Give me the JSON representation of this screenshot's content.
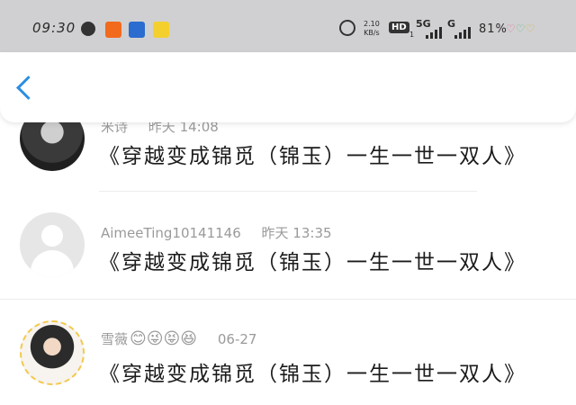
{
  "status_bar": {
    "time": "09:30",
    "net_speed_top": "2.10",
    "net_speed_bottom": "KB/s",
    "hd": "HD",
    "hd_sub": "1",
    "sig1": "5G",
    "sig2": "G",
    "battery": "81%",
    "icons": [
      "globe-icon",
      "app-icon",
      "baidu-icon",
      "app-icon",
      "alarm-icon"
    ]
  },
  "header": {
    "back_icon": "chevron-left-icon"
  },
  "comments": [
    {
      "user": "米诗",
      "time": "昨天 14:08",
      "text": "《穿越变成锦觅（锦玉）一生一世一双人》"
    },
    {
      "user": "AimeeTing10141146",
      "time": "昨天 13:35",
      "text": "《穿越变成锦觅（锦玉）一生一世一双人》"
    },
    {
      "user": "雪薇",
      "emojis": "😊😜😝😆",
      "time": "06-27",
      "text": "《穿越变成锦觅（锦玉）一生一世一双人》"
    }
  ],
  "colors": {
    "accent": "#2b8ee0",
    "statusbar_bg": "#d0d0d2",
    "meta": "#9a9a9a"
  }
}
